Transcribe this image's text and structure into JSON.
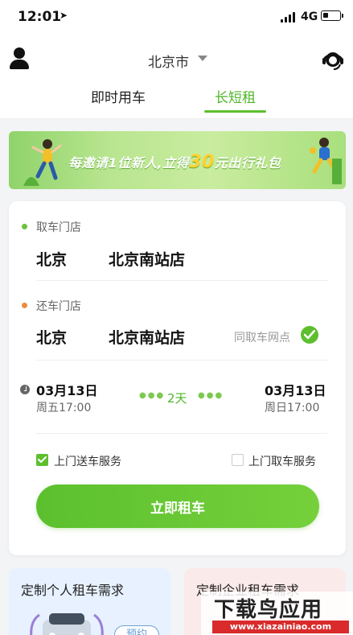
{
  "status_bar": {
    "time": "12:01",
    "network": "4G",
    "battery_level": 0.3
  },
  "header": {
    "city": "北京市",
    "tabs": [
      {
        "label": "即时用车",
        "active": false
      },
      {
        "label": "长短租",
        "active": true
      }
    ]
  },
  "banner": {
    "text_before": "每邀请1位新人,立得",
    "amount": "30",
    "text_after": "元出行礼包"
  },
  "pickup": {
    "label": "取车门店",
    "city": "北京",
    "store": "北京南站店"
  },
  "return": {
    "label": "还车门店",
    "city": "北京",
    "store": "北京南站店",
    "same_store_label": "同取车网点",
    "same_store_checked": true
  },
  "schedule": {
    "start_date": "03月13日",
    "start_time": "周五17:00",
    "duration": "2天",
    "end_date": "03月13日",
    "end_time": "周日17:00"
  },
  "options": [
    {
      "label": "上门送车服务",
      "checked": true
    },
    {
      "label": "上门取车服务",
      "checked": false
    }
  ],
  "rent_button": "立即租车",
  "mini_cards": [
    {
      "title": "定制个人租车需求",
      "button": "预约"
    },
    {
      "title": "定制企业租车需求"
    }
  ],
  "watermark": {
    "title": "下载鸟应用",
    "url": "www.xiazainiao.com"
  },
  "colors": {
    "accent": "#5dbf2f",
    "pickup_dot": "#6dc23a",
    "return_dot": "#f08a3c"
  },
  "icons": [
    "location-arrow-icon",
    "signal-icon",
    "battery-icon",
    "user-icon",
    "caret-down-icon",
    "customer-service-icon",
    "check-icon",
    "clock-icon"
  ]
}
